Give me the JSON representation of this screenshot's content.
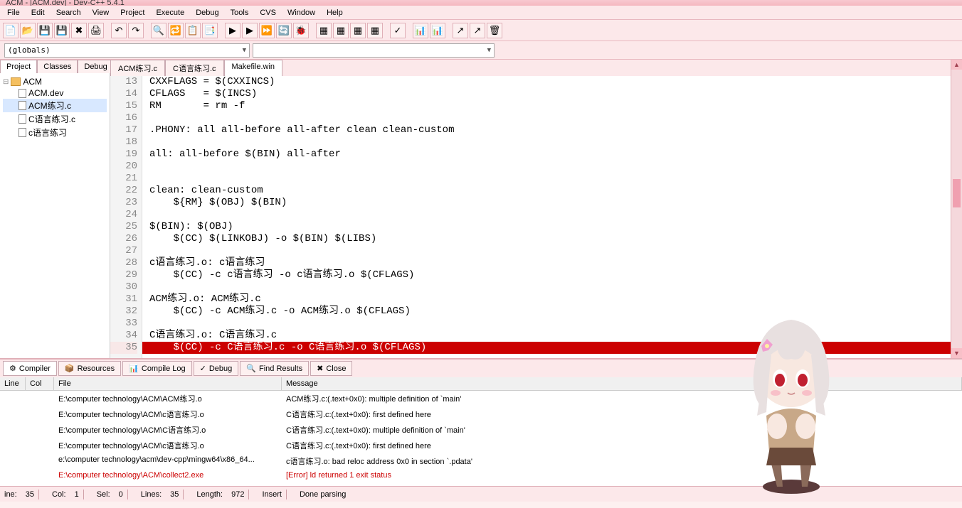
{
  "title": "ACM - [ACM.dev] - Dev-C++ 5.4.1",
  "menu": [
    "File",
    "Edit",
    "Search",
    "View",
    "Project",
    "Execute",
    "Debug",
    "Tools",
    "CVS",
    "Window",
    "Help"
  ],
  "globals_combo": "(globals)",
  "left_tabs": [
    "Project",
    "Classes",
    "Debug"
  ],
  "tree_root": "ACM",
  "tree_items": [
    "ACM.dev",
    "ACM练习.c",
    "C语言练习.c",
    "c语言练习"
  ],
  "editor_tabs": [
    "ACM练习.c",
    "C语言练习.c",
    "Makefile.win"
  ],
  "code_lines": [
    {
      "n": 13,
      "t": "CXXFLAGS = $(CXXINCS)"
    },
    {
      "n": 14,
      "t": "CFLAGS   = $(INCS)"
    },
    {
      "n": 15,
      "t": "RM       = rm -f"
    },
    {
      "n": 16,
      "t": ""
    },
    {
      "n": 17,
      "t": ".PHONY: all all-before all-after clean clean-custom"
    },
    {
      "n": 18,
      "t": ""
    },
    {
      "n": 19,
      "t": "all: all-before $(BIN) all-after"
    },
    {
      "n": 20,
      "t": ""
    },
    {
      "n": 21,
      "t": ""
    },
    {
      "n": 22,
      "t": "clean: clean-custom"
    },
    {
      "n": 23,
      "t": "    ${RM} $(OBJ) $(BIN)"
    },
    {
      "n": 24,
      "t": ""
    },
    {
      "n": 25,
      "t": "$(BIN): $(OBJ)"
    },
    {
      "n": 26,
      "t": "    $(CC) $(LINKOBJ) -o $(BIN) $(LIBS)"
    },
    {
      "n": 27,
      "t": ""
    },
    {
      "n": 28,
      "t": "c语言练习.o: c语言练习"
    },
    {
      "n": 29,
      "t": "    $(CC) -c c语言练习 -o c语言练习.o $(CFLAGS)"
    },
    {
      "n": 30,
      "t": ""
    },
    {
      "n": 31,
      "t": "ACM练习.o: ACM练习.c"
    },
    {
      "n": 32,
      "t": "    $(CC) -c ACM练习.c -o ACM练习.o $(CFLAGS)"
    },
    {
      "n": 33,
      "t": ""
    },
    {
      "n": 34,
      "t": "C语言练习.o: C语言练习.c"
    },
    {
      "n": 35,
      "t": "    $(CC) -c C语言练习.c -o C语言练习.o $(CFLAGS)",
      "err": true
    }
  ],
  "bottom_tabs": [
    {
      "icon": "⚙",
      "label": "Compiler"
    },
    {
      "icon": "📦",
      "label": "Resources"
    },
    {
      "icon": "📊",
      "label": "Compile Log"
    },
    {
      "icon": "✓",
      "label": "Debug"
    },
    {
      "icon": "🔍",
      "label": "Find Results"
    },
    {
      "icon": "✖",
      "label": "Close"
    }
  ],
  "msg_headers": {
    "line": "Line",
    "col": "Col",
    "file": "File",
    "msg": "Message"
  },
  "messages": [
    {
      "line": "",
      "col": "",
      "file": "E:\\computer technology\\ACM\\ACM练习.o",
      "msg": "ACM练习.c:(.text+0x0): multiple definition of `main'"
    },
    {
      "line": "",
      "col": "",
      "file": "E:\\computer technology\\ACM\\c语言练习.o",
      "msg": "C语言练习.c:(.text+0x0): first defined here"
    },
    {
      "line": "",
      "col": "",
      "file": "E:\\computer technology\\ACM\\C语言练习.o",
      "msg": "C语言练习.c:(.text+0x0): multiple definition of `main'"
    },
    {
      "line": "",
      "col": "",
      "file": "E:\\computer technology\\ACM\\c语言练习.o",
      "msg": "C语言练习.c:(.text+0x0): first defined here"
    },
    {
      "line": "",
      "col": "",
      "file": "e:\\computer technology\\acm\\dev-cpp\\mingw64\\x86_64...",
      "msg": "c语言练习.o: bad reloc address 0x0 in section `.pdata'"
    },
    {
      "line": "",
      "col": "",
      "file": "E:\\computer technology\\ACM\\collect2.exe",
      "msg": "[Error] ld returned 1 exit status",
      "error": true
    }
  ],
  "status": {
    "line_lbl": "ine:",
    "line": "35",
    "col_lbl": "Col:",
    "col": "1",
    "sel_lbl": "Sel:",
    "sel": "0",
    "lines_lbl": "Lines:",
    "lines": "35",
    "len_lbl": "Length:",
    "len": "972",
    "insert": "Insert",
    "parsing": "Done parsing"
  }
}
